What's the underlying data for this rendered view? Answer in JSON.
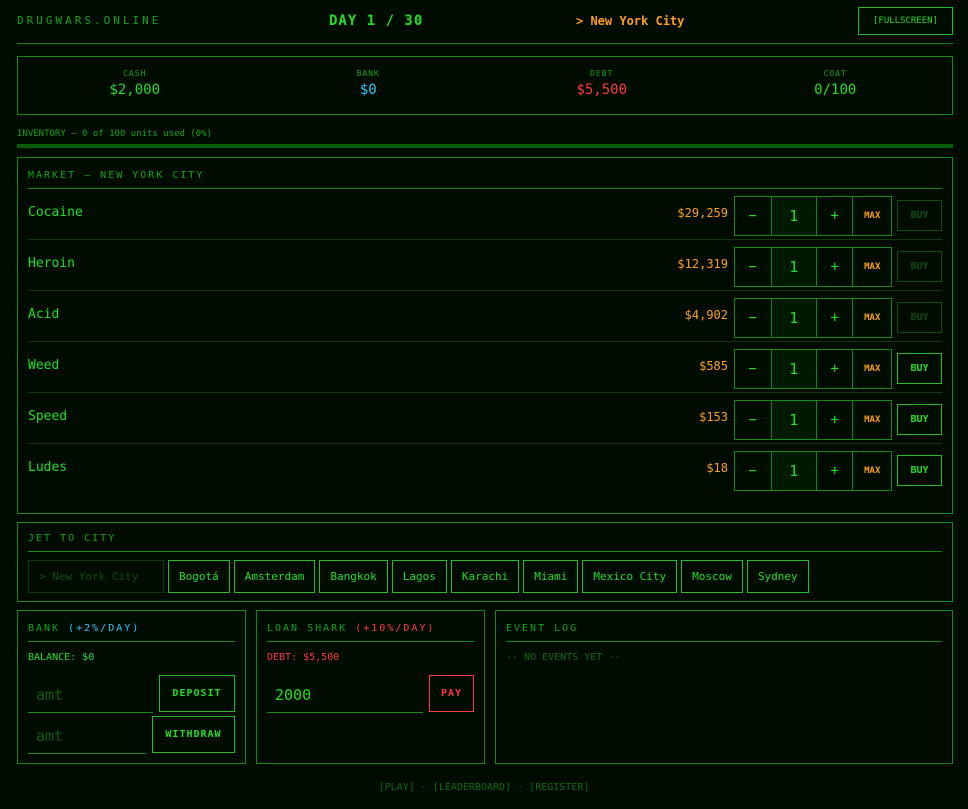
{
  "header": {
    "brand": "DRUGWARS.ONLINE",
    "day": "DAY 1 / 30",
    "location": "> New York City",
    "fullscreen": "[FULLSCREEN]"
  },
  "stats": {
    "cash_label": "CASH",
    "cash": "$2,000",
    "bank_label": "BANK",
    "bank": "$0",
    "debt_label": "DEBT",
    "debt": "$5,500",
    "coat_label": "COAT",
    "coat": "0/100"
  },
  "inventory": {
    "label": "INVENTORY — 0 of 100 units used (0%)",
    "used_fraction": 0
  },
  "market": {
    "title": "MARKET — NEW YORK CITY",
    "minus": "−",
    "plus": "+",
    "max": "MAX",
    "buy": "BUY",
    "items": [
      {
        "name": "Cocaine",
        "price": "$29,259",
        "qty": "1",
        "buy_enabled": false
      },
      {
        "name": "Heroin",
        "price": "$12,319",
        "qty": "1",
        "buy_enabled": false
      },
      {
        "name": "Acid",
        "price": "$4,902",
        "qty": "1",
        "buy_enabled": false
      },
      {
        "name": "Weed",
        "price": "$585",
        "qty": "1",
        "buy_enabled": true
      },
      {
        "name": "Speed",
        "price": "$153",
        "qty": "1",
        "buy_enabled": true
      },
      {
        "name": "Ludes",
        "price": "$18",
        "qty": "1",
        "buy_enabled": true
      }
    ]
  },
  "jet": {
    "title": "JET TO CITY",
    "current": "> New York City",
    "cities": [
      "Bogotá",
      "Amsterdam",
      "Bangkok",
      "Lagos",
      "Karachi",
      "Miami",
      "Mexico City",
      "Moscow",
      "Sydney"
    ]
  },
  "bank": {
    "title": "BANK",
    "rate": "(+2%/DAY)",
    "balance": "BALANCE: $0",
    "deposit_placeholder": "amt",
    "withdraw_placeholder": "amt",
    "deposit": "DEPOSIT",
    "withdraw": "WITHDRAW"
  },
  "loan": {
    "title": "LOAN SHARK",
    "rate": "(+10%/DAY)",
    "debt": "DEBT: $5,500",
    "amount": "2000",
    "pay": "PAY"
  },
  "events": {
    "title": "EVENT LOG",
    "empty": "-- NO EVENTS YET --"
  },
  "footer": {
    "play": "[PLAY]",
    "leaderboard": "[LEADERBOARD]",
    "register": "[REGISTER]",
    "sep": "·"
  },
  "colors": {
    "primary": "#22dd22",
    "price": "#ff9f1a",
    "debt": "#ff3b3b",
    "bank": "#2ec7ff"
  }
}
